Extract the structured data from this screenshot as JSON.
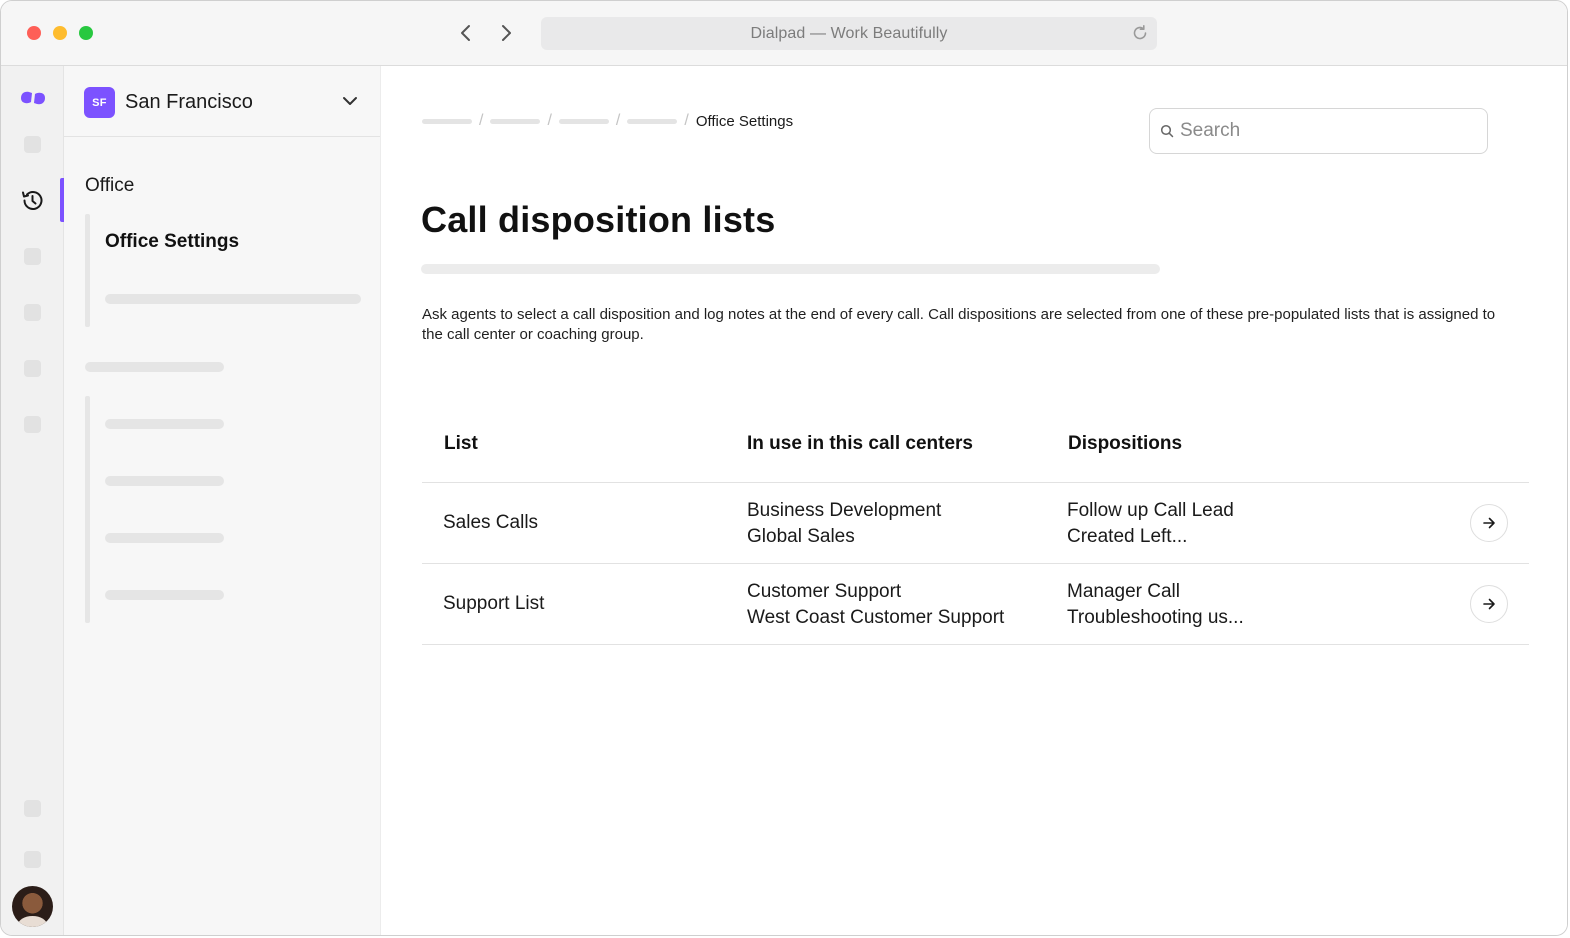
{
  "browser": {
    "url_title": "Dialpad — Work Beautifully"
  },
  "office_switcher": {
    "badge": "SF",
    "name": "San Francisco"
  },
  "sidebar": {
    "section": "Office",
    "active_item": "Office Settings"
  },
  "breadcrumb": {
    "current": "Office Settings"
  },
  "search": {
    "placeholder": "Search"
  },
  "page": {
    "title": "Call disposition lists",
    "description": "Ask agents to select a call disposition and log notes at the end of every call. Call dispositions are selected from one of these pre-populated lists that is assigned to the call center or coaching group."
  },
  "table": {
    "headers": {
      "list": "List",
      "in_use": "In use in this call centers",
      "dispositions": "Dispositions"
    },
    "rows": [
      {
        "list": "Sales Calls",
        "centers": [
          "Business Development",
          "Global Sales"
        ],
        "dispositions": [
          "Follow up Call Lead",
          "Created Left..."
        ]
      },
      {
        "list": "Support List",
        "centers": [
          "Customer Support",
          "West Coast Customer Support"
        ],
        "dispositions": [
          "Manager Call",
          "Troubleshooting us..."
        ]
      }
    ]
  },
  "colors": {
    "accent": "#7c52ff",
    "traffic_red": "#fe5f57",
    "traffic_yellow": "#febc2e",
    "traffic_green": "#28c840"
  },
  "icons": {
    "logo": "dialpad-logo-icon",
    "history": "history-icon",
    "chevron": "chevron-down-icon",
    "arrow": "arrow-right-icon",
    "search": "search-icon"
  }
}
